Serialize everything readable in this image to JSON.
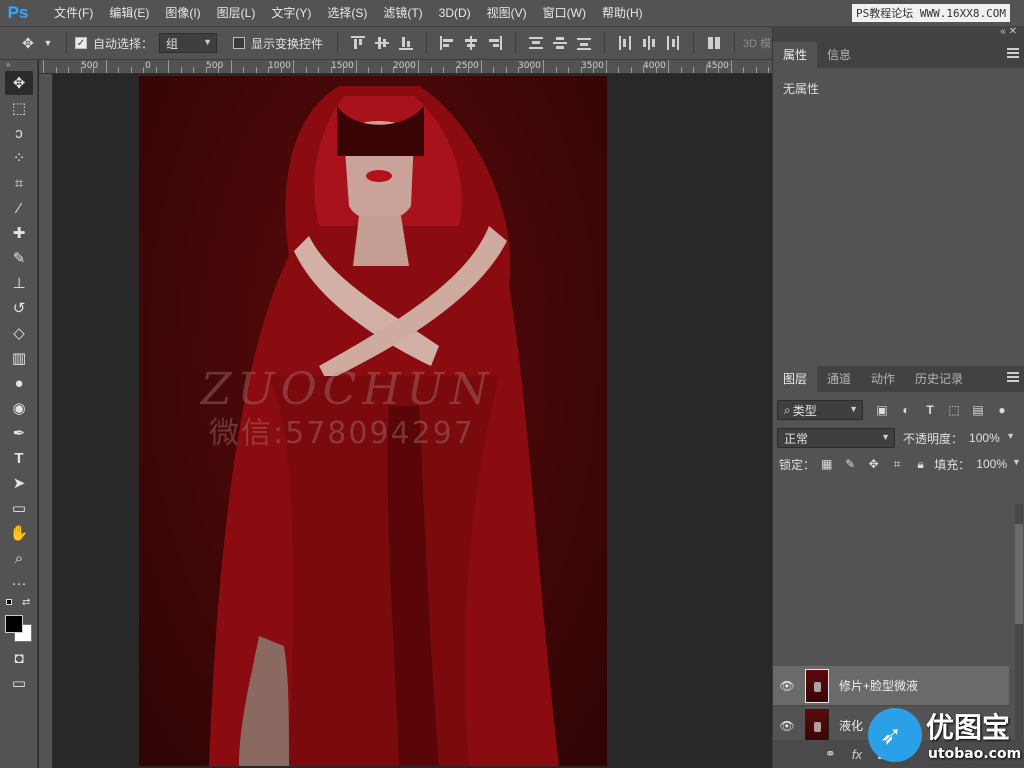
{
  "app": {
    "logo": "Ps"
  },
  "menu": [
    "文件(F)",
    "编辑(E)",
    "图像(I)",
    "图层(L)",
    "文字(Y)",
    "选择(S)",
    "滤镜(T)",
    "3D(D)",
    "视图(V)",
    "窗口(W)",
    "帮助(H)"
  ],
  "top_watermark": "PS教程论坛 WWW.16XX8.COM",
  "options": {
    "auto_select_label": "自动选择：",
    "auto_select_value": "组",
    "show_transform_label": "显示变换控件",
    "mode_3d": "3D 模"
  },
  "ruler": {
    "labels": [
      "500",
      "0",
      "500",
      "1000",
      "1500",
      "2000",
      "2500",
      "3000",
      "3500",
      "4000",
      "4500"
    ]
  },
  "canvas": {
    "watermark_name": "ZUOCHUN",
    "watermark_wechat": "微信:578094297"
  },
  "properties_panel": {
    "tabs": [
      "属性",
      "信息"
    ],
    "empty_text": "无属性"
  },
  "layers_panel": {
    "tabs": [
      "图层",
      "通道",
      "动作",
      "历史记录"
    ],
    "filter_type": "类型",
    "blend_mode": "正常",
    "opacity_label": "不透明度：",
    "opacity_value": "100%",
    "lock_label": "锁定：",
    "fill_label": "填充：",
    "fill_value": "100%",
    "layers": [
      {
        "name": "修片+脸型微液",
        "selected": true,
        "visible": true
      },
      {
        "name": "液化",
        "selected": false,
        "visible": true
      }
    ],
    "footer_fx": "fx"
  },
  "brand": {
    "name": "优图宝",
    "url": "utobao.com"
  }
}
